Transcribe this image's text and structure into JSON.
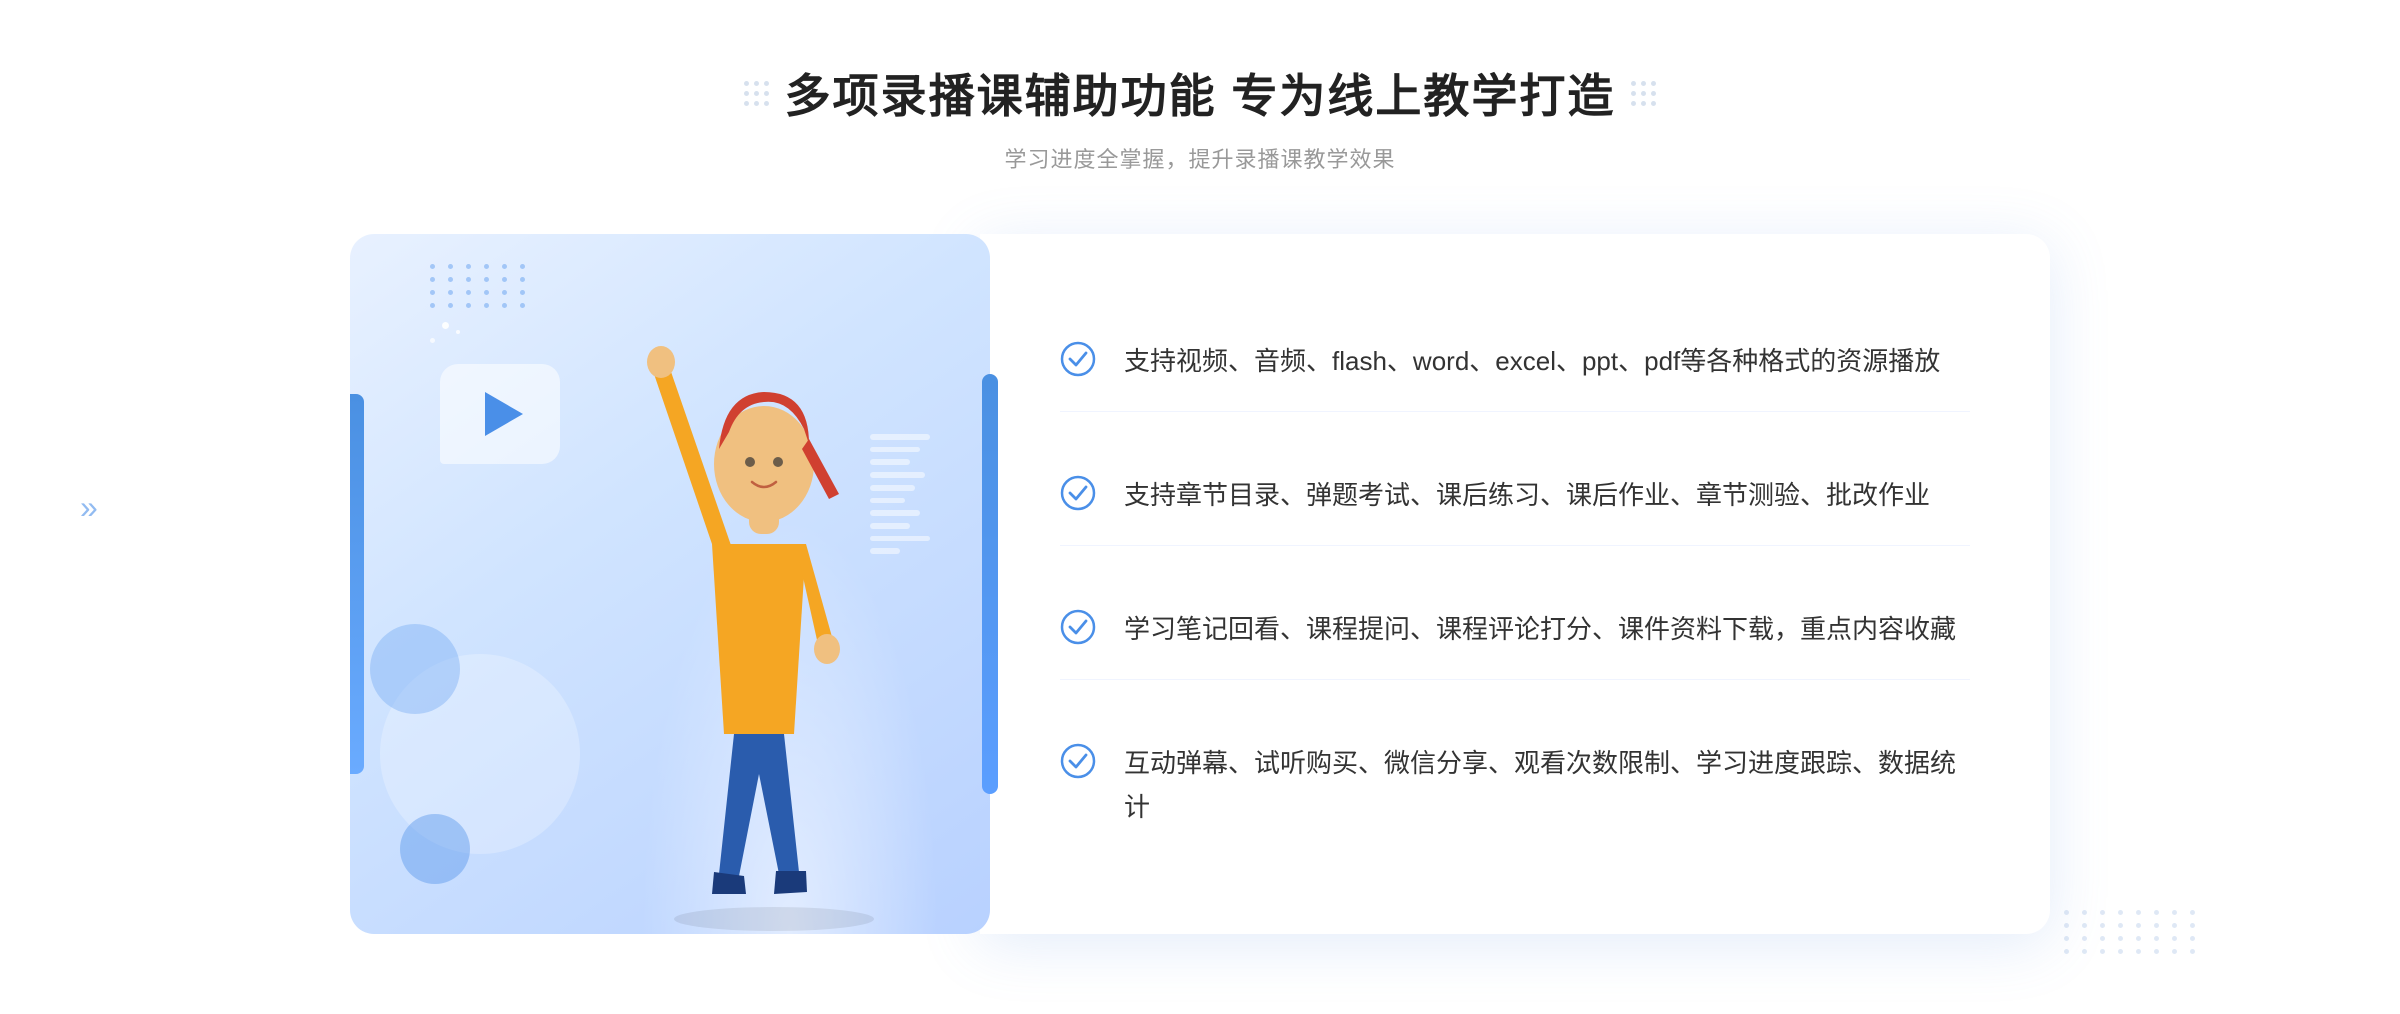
{
  "header": {
    "title": "多项录播课辅助功能 专为线上教学打造",
    "subtitle": "学习进度全掌握，提升录播课教学效果"
  },
  "features": [
    {
      "id": "feature-1",
      "text": "支持视频、音频、flash、word、excel、ppt、pdf等各种格式的资源播放"
    },
    {
      "id": "feature-2",
      "text": "支持章节目录、弹题考试、课后练习、课后作业、章节测验、批改作业"
    },
    {
      "id": "feature-3",
      "text": "学习笔记回看、课程提问、课程评论打分、课件资料下载，重点内容收藏"
    },
    {
      "id": "feature-4",
      "text": "互动弹幕、试听购买、微信分享、观看次数限制、学习进度跟踪、数据统计"
    }
  ],
  "accent_color": "#4a8fe8",
  "check_color": "#4a8fe8"
}
